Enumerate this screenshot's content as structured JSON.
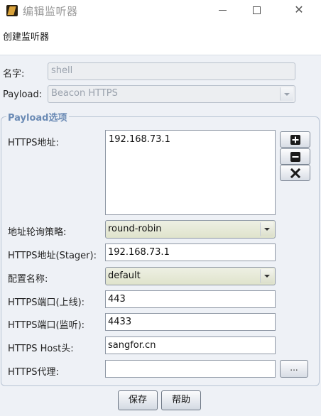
{
  "window": {
    "title": "编辑监听器",
    "minimize_icon": "minimize-icon",
    "maximize_icon": "maximize-icon",
    "close_symbol": "✕"
  },
  "header": {
    "description": "创建监听器"
  },
  "form": {
    "name_label": "名字:",
    "name_value": "shell",
    "payload_label": "Payload:",
    "payload_value": "Beacon HTTPS"
  },
  "payload_options": {
    "group_title": "Payload选项",
    "https_hosts_label": "HTTPS地址:",
    "https_hosts_value": "192.168.73.1",
    "add_icon": "plus-icon",
    "remove_icon": "minus-icon",
    "clear_icon": "x-icon",
    "rotation_label": "地址轮询策略:",
    "rotation_value": "round-robin",
    "stager_label": "HTTPS地址(Stager):",
    "stager_value": "192.168.73.1",
    "profile_label": "配置名称:",
    "profile_value": "default",
    "port_label": "HTTPS端口(上线):",
    "port_value": "443",
    "bind_port_label": "HTTPS端口(监听):",
    "bind_port_value": "4433",
    "host_header_label": "HTTPS Host头:",
    "host_header_value": "sangfor.cn",
    "proxy_label": "HTTPS代理:",
    "proxy_value": "",
    "proxy_button_label": "..."
  },
  "actions": {
    "save_label": "保存",
    "help_label": "帮助"
  },
  "colors": {
    "group_title": "#6b8bb5",
    "panel_bg": "#eef1f6",
    "combo_active": "#dfe3cc"
  }
}
